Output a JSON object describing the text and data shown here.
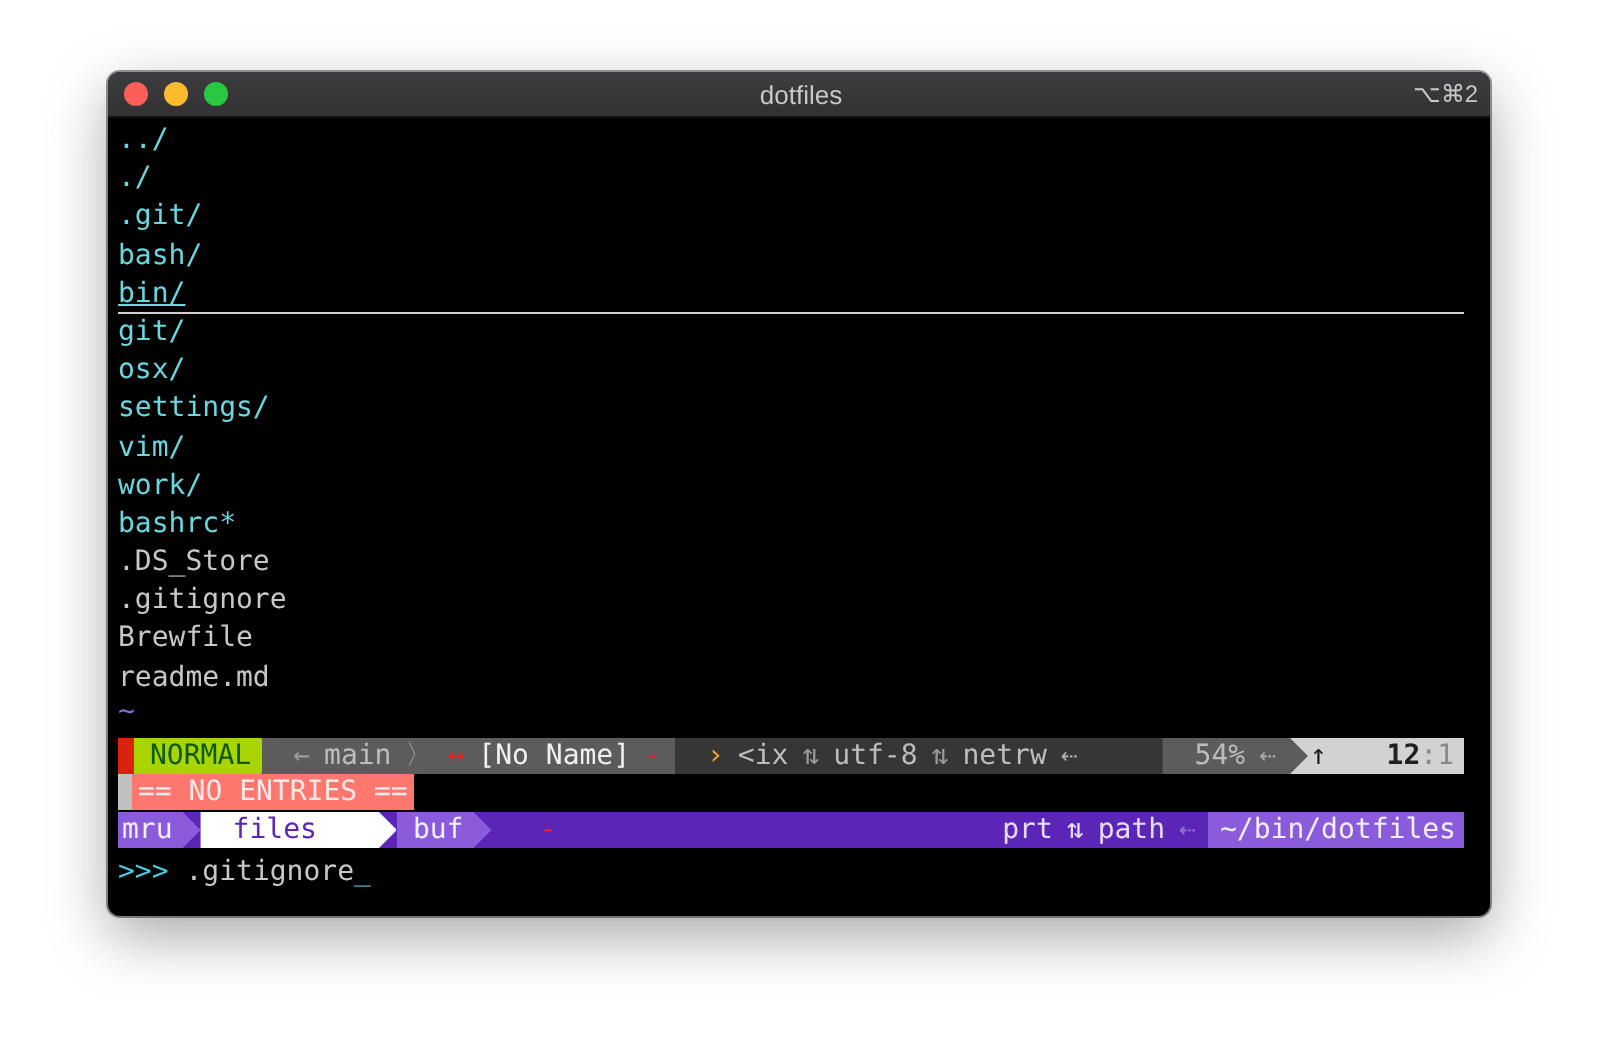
{
  "window": {
    "title": "dotfiles",
    "shortcut": "⌥⌘2"
  },
  "files": [
    {
      "name": "../",
      "kind": "dir",
      "selected": false
    },
    {
      "name": "./",
      "kind": "dir",
      "selected": false
    },
    {
      "name": ".git/",
      "kind": "dir",
      "selected": false
    },
    {
      "name": "bash/",
      "kind": "dir",
      "selected": false
    },
    {
      "name": "bin/",
      "kind": "dir",
      "selected": true
    },
    {
      "name": "git/",
      "kind": "dir",
      "selected": false
    },
    {
      "name": "osx/",
      "kind": "dir",
      "selected": false
    },
    {
      "name": "settings/",
      "kind": "dir",
      "selected": false
    },
    {
      "name": "vim/",
      "kind": "dir",
      "selected": false
    },
    {
      "name": "work/",
      "kind": "dir",
      "selected": false
    },
    {
      "name": "bashrc*",
      "kind": "exec",
      "selected": false
    },
    {
      "name": ".DS_Store",
      "kind": "file",
      "selected": false
    },
    {
      "name": ".gitignore",
      "kind": "file",
      "selected": false
    },
    {
      "name": "Brewfile",
      "kind": "file",
      "selected": false
    },
    {
      "name": "readme.md",
      "kind": "file",
      "selected": false
    }
  ],
  "end_marker": "~",
  "statusline": [
    {
      "kind": "edge"
    },
    {
      "kind": "mode",
      "items": [
        {
          "kind": "mode",
          "text": "NORMAL"
        }
      ]
    },
    {
      "kind": "info",
      "items": [
        {
          "kind": "glyph",
          "text": "←"
        },
        {
          "kind": "text",
          "text": "main"
        },
        {
          "kind": "glyph",
          "text": "〉"
        },
        {
          "kind": "alert",
          "text": "↔"
        },
        {
          "kind": "bright",
          "text": "[No Name]"
        },
        {
          "kind": "alert",
          "text": "-"
        }
      ]
    },
    {
      "kind": "file",
      "items": [
        {
          "kind": "accent",
          "text": "›"
        },
        {
          "kind": "text",
          "text": "<ix"
        },
        {
          "kind": "glyph",
          "text": "⇅"
        },
        {
          "kind": "text",
          "text": "utf-8"
        },
        {
          "kind": "glyph",
          "text": "⇅"
        },
        {
          "kind": "text",
          "text": "netrw"
        },
        {
          "kind": "dim",
          "text": "⇠"
        }
      ]
    },
    {
      "kind": "info",
      "items": [
        {
          "kind": "text",
          "text": "54%"
        },
        {
          "kind": "dim",
          "text": "⇠"
        }
      ]
    },
    {
      "kind": "position",
      "items": [
        {
          "kind": "dark",
          "text": "↑"
        },
        {
          "kind": "dark",
          "text": "12"
        },
        {
          "kind": "faint",
          "text": ":1"
        }
      ]
    }
  ],
  "message": "== NO ENTRIES ==",
  "ctrlp": {
    "modes": [
      {
        "label": "mru",
        "selected": false
      },
      {
        "label": "files",
        "selected": true
      },
      {
        "label": "buf",
        "selected": false
      }
    ],
    "marker": "-",
    "right": [
      {
        "kind": "text",
        "text": "prt"
      },
      {
        "kind": "glyph",
        "text": "⇅"
      },
      {
        "kind": "text",
        "text": "path"
      },
      {
        "kind": "dim",
        "text": "⇠"
      }
    ],
    "cwd": "~/bin/dotfiles"
  },
  "prompt": {
    "prefix": ">>>",
    "input": ".gitignore",
    "cursor": "_"
  }
}
